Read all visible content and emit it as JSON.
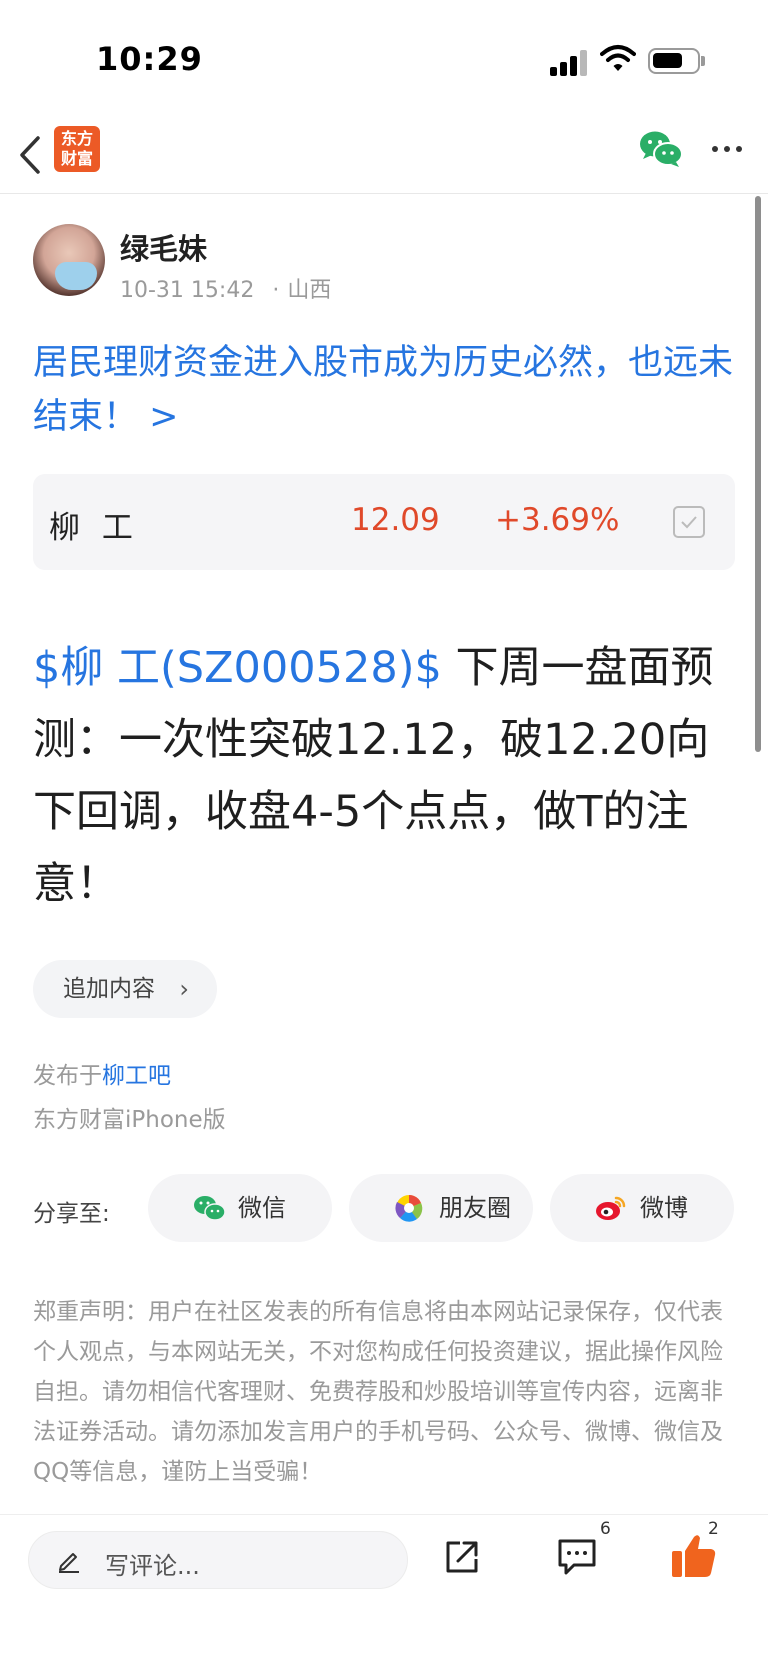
{
  "status_bar": {
    "time": "10:29",
    "battery_level": 0.6
  },
  "nav": {
    "logo_line1": "东方",
    "logo_line2": "财富"
  },
  "post": {
    "author": "绿毛妹",
    "datetime": "10-31 15:42",
    "location": "山西",
    "title": "居民理财资金进入股市成为历史必然，也远未结束！ >",
    "stock_card": {
      "name": "柳 工",
      "price": "12.09",
      "change": "+3.69%"
    },
    "body_stock_tag": "$柳  工(SZ000528)$",
    "body_text": "  下周一盘面预测：一次性突破12.12，破12.20向下回调，收盘4-5个点点，做T的注意！",
    "append_label": "追加内容",
    "published_prefix": "发布于",
    "forum": "柳工吧",
    "client": "东方财富iPhone版"
  },
  "share": {
    "label": "分享至:",
    "targets": [
      {
        "label": "微信",
        "icon": "wechat-icon"
      },
      {
        "label": "朋友圈",
        "icon": "moments-icon"
      },
      {
        "label": "微博",
        "icon": "weibo-icon"
      }
    ]
  },
  "disclaimer": "郑重声明：用户在社区发表的所有信息将由本网站记录保存，仅代表个人观点，与本网站无关，不对您构成任何投资建议，据此操作风险自担。请勿相信代客理财、免费荐股和炒股培训等宣传内容，远离非法证券活动。请勿添加发言用户的手机号码、公众号、微博、微信及QQ等信息，谨防上当受骗！",
  "bottom_bar": {
    "comment_placeholder": "写评论...",
    "comment_count": "6",
    "like_count": "2"
  },
  "colors": {
    "brand": "#ec5a26",
    "link": "#2675e0",
    "up": "#e0492a",
    "wechat": "#2aae67"
  }
}
